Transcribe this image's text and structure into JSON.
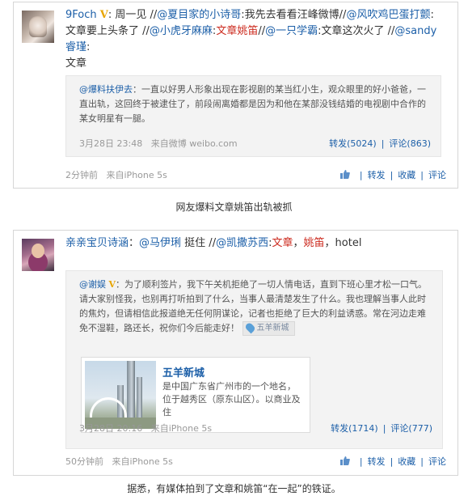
{
  "post1": {
    "username": "9Foch",
    "vip_badge": "V",
    "text_parts": [
      ": 周一见 //",
      "@夏目家的小诗哥",
      ":我先去看看汪峰微博//",
      "@风吹鸡巴蛋打颤",
      ": 文章要上头条了 //",
      "@小虎牙麻麻",
      ":",
      "文章姚笛",
      "//",
      "@一只学霸",
      ":文章这次火了 //",
      "@sandy睿瑾",
      ":",
      "文章"
    ],
    "quote": {
      "author": "@爆料扶伊去",
      "text": "：一直以好男人形象出现在影视剧的某当红小生，观众眼里的好小爸爸，一直出轨，这回终于被逮住了，前段闹离婚都是因为和他在某部没钱结婚的电视剧中合作的某女明星有一腿。",
      "time": "3月28日 23:48",
      "source": "来自微博 weibo.com",
      "repost": "转发(5024)",
      "comment": "评论(863)"
    },
    "time": "2分钟前",
    "source": "来自iPhone 5s",
    "actions": {
      "repost": "转发",
      "fav": "收藏",
      "comment": "评论"
    }
  },
  "caption1": "网友爆料文章姚笛出轨被抓",
  "post2": {
    "username": "亲亲宝贝诗涵",
    "colon1": "：",
    "mention1": "@马伊琍",
    "text1": " 挺住 //",
    "mention2": "@凯撒苏西",
    "colon2": ":",
    "hl1": "文章",
    "comma": "，",
    "hl2": "姚笛",
    "text2": "，hotel",
    "quote": {
      "author": "@谢娱",
      "vip_badge": "V",
      "text": "：为了顺利签片，我下午关机拒绝了一切人情电话，直到下班心里才松一口气。请大家别怪我，也别再打听拍到了什么，当事人最清楚发生了什么。我也理解当事人此时的焦灼，但请相信此报道绝无任何阴谋论，记者也拒绝了巨大的利益诱惑。常在河边走难免不湿鞋，路还长，祝你们今后能走好！",
      "location_tag": "五羊新城",
      "location_card": {
        "title": "五羊新城",
        "desc": "是中国广东省广州市的一个地名，位于越秀区（原东山区）。以商业及住"
      },
      "time": "3月28日 20:16",
      "source": "来自iPhone 5s",
      "repost": "转发(1714)",
      "comment": "评论(777)"
    },
    "time": "50分钟前",
    "source": "来自iPhone 5s",
    "actions": {
      "repost": "转发",
      "fav": "收藏",
      "comment": "评论"
    }
  },
  "caption2": "据悉，有媒体拍到了文章和姚笛“在一起”的铁证。"
}
